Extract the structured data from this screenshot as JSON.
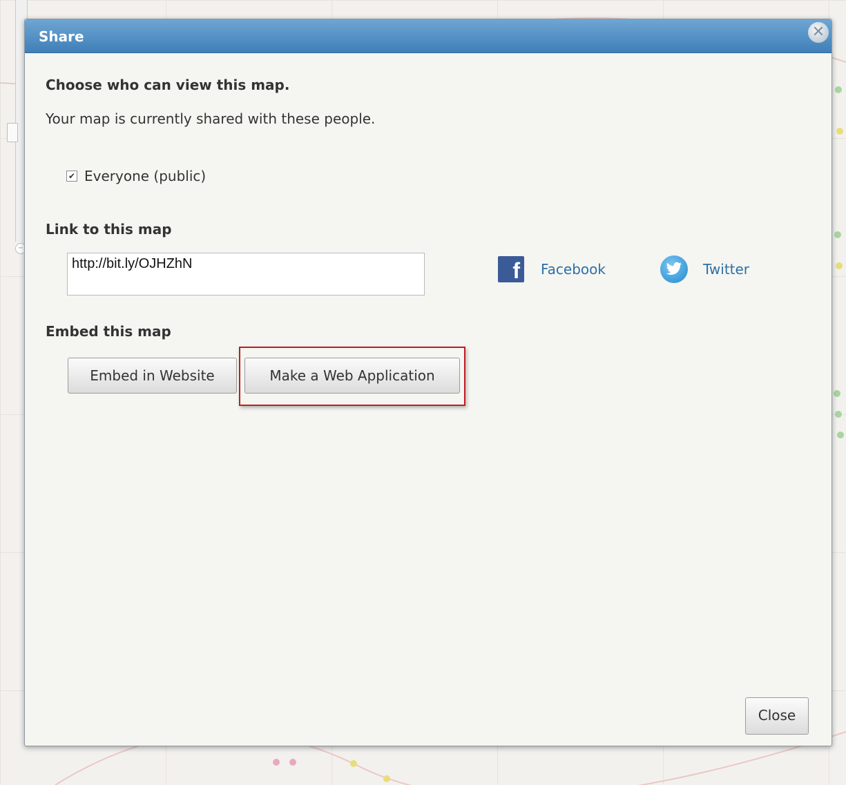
{
  "dialog": {
    "title": "Share",
    "close_icon": "close-x-icon"
  },
  "viewers": {
    "heading": "Choose who can view this map.",
    "description": "Your map is currently shared with these people.",
    "everyone_label": "Everyone (public)",
    "everyone_checked": true
  },
  "link": {
    "heading": "Link to this map",
    "url": "http://bit.ly/OJHZhN",
    "facebook_label": "Facebook",
    "twitter_label": "Twitter"
  },
  "embed": {
    "heading": "Embed this map",
    "embed_website_label": "Embed in Website",
    "web_app_label": "Make a Web Application"
  },
  "footer": {
    "close_label": "Close"
  },
  "colors": {
    "title_bar": "#3e7fb8",
    "highlight": "#c01b22",
    "link_text": "#2d6fa6"
  }
}
